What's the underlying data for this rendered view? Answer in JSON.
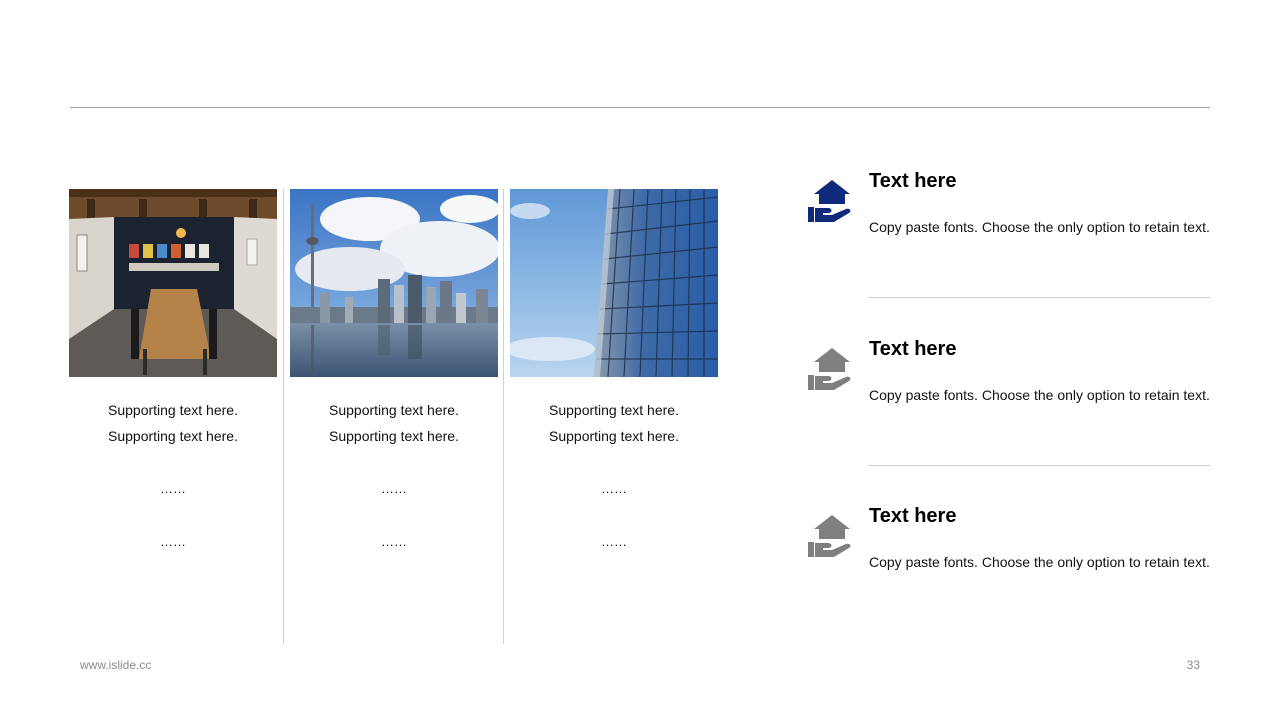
{
  "columns": [
    {
      "image": "meeting-room-photo",
      "lines": [
        "Supporting  text here.",
        "Supporting  text here."
      ],
      "dots": [
        "……",
        "……"
      ]
    },
    {
      "image": "city-skyline-photo",
      "lines": [
        "Supporting  text here.",
        "Supporting  text here."
      ],
      "dots": [
        "……",
        "……"
      ]
    },
    {
      "image": "glass-building-photo",
      "lines": [
        "Supporting  text here.",
        "Supporting  text here."
      ],
      "dots": [
        "……",
        "……"
      ]
    }
  ],
  "items": [
    {
      "icon": "hand-house-icon",
      "icon_color": "#0f2a7a",
      "title": "Text here",
      "desc": "Copy paste fonts. Choose the only option to retain text."
    },
    {
      "icon": "hand-house-icon",
      "icon_color": "#7f7f7f",
      "title": "Text here",
      "desc": "Copy paste fonts. Choose the only option to retain text."
    },
    {
      "icon": "hand-house-icon",
      "icon_color": "#7f7f7f",
      "title": "Text here",
      "desc": "Copy paste fonts. Choose the only option to retain text."
    }
  ],
  "footer": {
    "url": "www.islide.cc",
    "page": "33"
  }
}
